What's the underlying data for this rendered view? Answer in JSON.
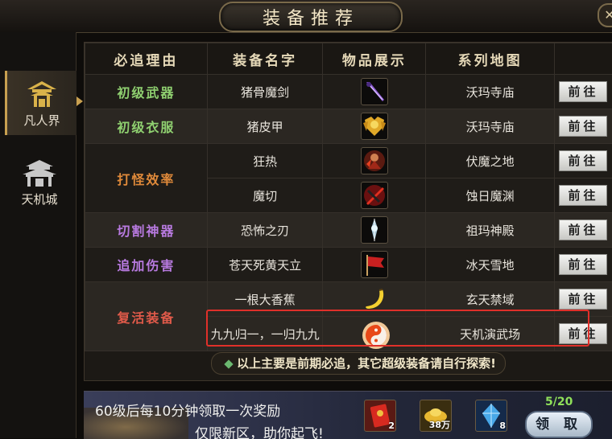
{
  "window": {
    "title": "装备推荐",
    "close_label": "✕"
  },
  "sidebar": {
    "items": [
      {
        "label": "凡人界",
        "icon": "pavilion-icon",
        "active": true
      },
      {
        "label": "天机城",
        "icon": "palace-icon",
        "active": false
      }
    ]
  },
  "table": {
    "headers": [
      "必追理由",
      "装备名字",
      "物品展示",
      "系列地图",
      ""
    ],
    "groups": [
      {
        "reason": "初级武器",
        "color": "#8fd070"
      },
      {
        "reason": "初级衣服",
        "color": "#8fd070"
      },
      {
        "reason": "打怪效率",
        "color": "#e08a3a"
      },
      {
        "reason": "切割神器",
        "color": "#b87ae0"
      },
      {
        "reason": "追加伤害",
        "color": "#b87ae0"
      },
      {
        "reason": "复活装备",
        "color": "#e05a4a"
      }
    ],
    "rows": [
      {
        "name": "猪骨魔剑",
        "map": "沃玛寺庙",
        "icon": "purple-sword-icon",
        "go": "前往"
      },
      {
        "name": "猪皮甲",
        "map": "沃玛寺庙",
        "icon": "golden-armor-icon",
        "go": "前往"
      },
      {
        "name": "狂热",
        "map": "伏魔之地",
        "icon": "fire-warrior-icon",
        "go": "前往"
      },
      {
        "name": "魔切",
        "map": "蚀日魔渊",
        "icon": "red-blade-icon",
        "go": "前往"
      },
      {
        "name": "恐怖之刃",
        "map": "祖玛神殿",
        "icon": "crystal-blade-icon",
        "go": "前往"
      },
      {
        "name": "苍天死黄天立",
        "map": "冰天雪地",
        "icon": "red-flag-icon",
        "go": "前往"
      },
      {
        "name": "一根大香蕉",
        "map": "玄天禁域",
        "icon": "banana-icon",
        "go": "前往"
      },
      {
        "name": "九九归一，一归九九",
        "map": "天机演武场",
        "icon": "taiji-orb-icon",
        "go": "前往"
      }
    ]
  },
  "notice": "以上主要是前期必追，其它超级装备请自行探索!",
  "reward_bar": {
    "line1": "60级后每10分钟领取一次奖励",
    "line2": "仅限新区，助你起飞!",
    "progress": "5/20",
    "items": [
      {
        "icon": "red-envelope-icon",
        "count": "2"
      },
      {
        "icon": "gold-ingot-icon",
        "count": "38万"
      },
      {
        "icon": "blue-crystal-icon",
        "count": "8"
      }
    ],
    "claim_label": "领 取"
  },
  "colors": {
    "accent_gold": "#c8a050",
    "highlight_red": "#e0302a",
    "progress_green": "#8fe05a"
  }
}
